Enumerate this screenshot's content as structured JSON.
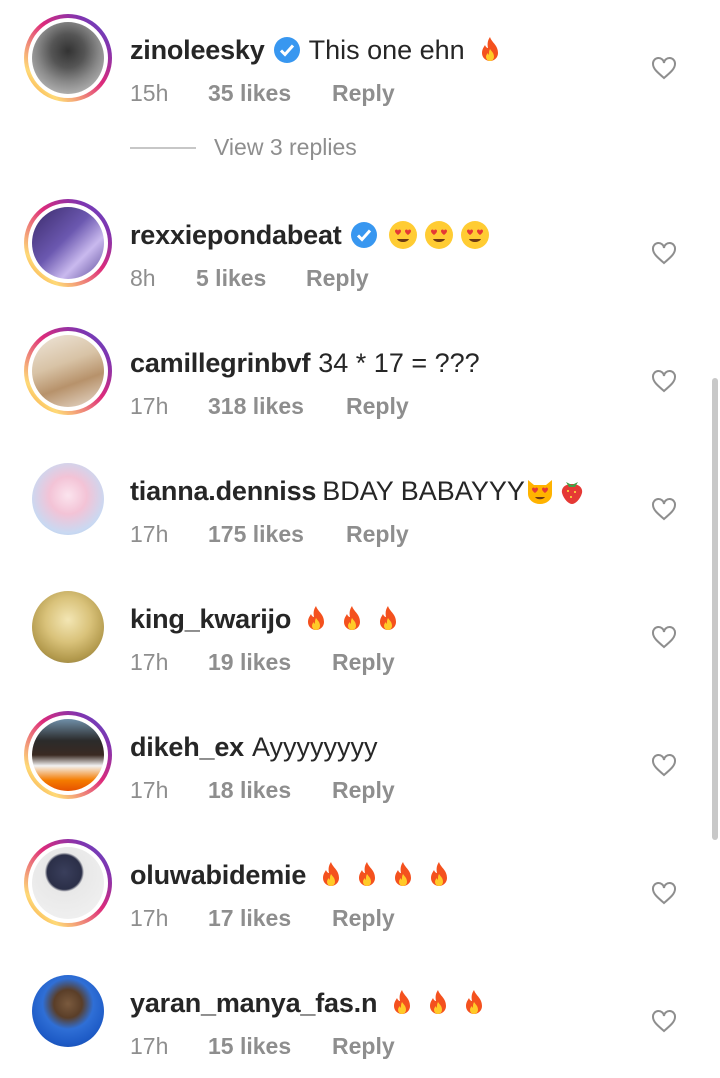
{
  "comments": [
    {
      "username": "zinoleesky",
      "verified": true,
      "text": "This one ehn",
      "emojis": [
        "fire"
      ],
      "time": "15h",
      "likes": "35 likes",
      "reply": "Reply",
      "story_ring": true
    },
    {
      "username": "rexxiepondabeat",
      "verified": true,
      "text": "",
      "emojis": [
        "heart-eyes",
        "heart-eyes",
        "heart-eyes"
      ],
      "time": "8h",
      "likes": "5 likes",
      "reply": "Reply",
      "story_ring": true
    },
    {
      "username": "camillegrinbvf",
      "verified": false,
      "text": "34 * 17 = ???",
      "emojis": [],
      "time": "17h",
      "likes": "318 likes",
      "reply": "Reply",
      "story_ring": true
    },
    {
      "username": "tianna.denniss",
      "verified": false,
      "text": "BDAY BABAYYY",
      "emojis": [
        "heart-eyes-cat",
        "strawberry"
      ],
      "time": "17h",
      "likes": "175 likes",
      "reply": "Reply",
      "story_ring": false
    },
    {
      "username": "king_kwarijo",
      "verified": false,
      "text": "",
      "emojis": [
        "fire",
        "fire",
        "fire"
      ],
      "time": "17h",
      "likes": "19 likes",
      "reply": "Reply",
      "story_ring": false
    },
    {
      "username": "dikeh_ex",
      "verified": false,
      "text": "Ayyyyyyyy",
      "emojis": [],
      "time": "17h",
      "likes": "18 likes",
      "reply": "Reply",
      "story_ring": true
    },
    {
      "username": "oluwabidemie",
      "verified": false,
      "text": "",
      "emojis": [
        "fire",
        "fire",
        "fire",
        "fire"
      ],
      "time": "17h",
      "likes": "17 likes",
      "reply": "Reply",
      "story_ring": true
    },
    {
      "username": "yaran_manya_fas.n",
      "verified": false,
      "text": "",
      "emojis": [
        "fire",
        "fire",
        "fire"
      ],
      "time": "17h",
      "likes": "15 likes",
      "reply": "Reply",
      "story_ring": false
    }
  ],
  "view_replies": "View 3 replies",
  "colors": {
    "verified": "#3897f0",
    "muted": "#8e8e8e",
    "text": "#262626"
  }
}
